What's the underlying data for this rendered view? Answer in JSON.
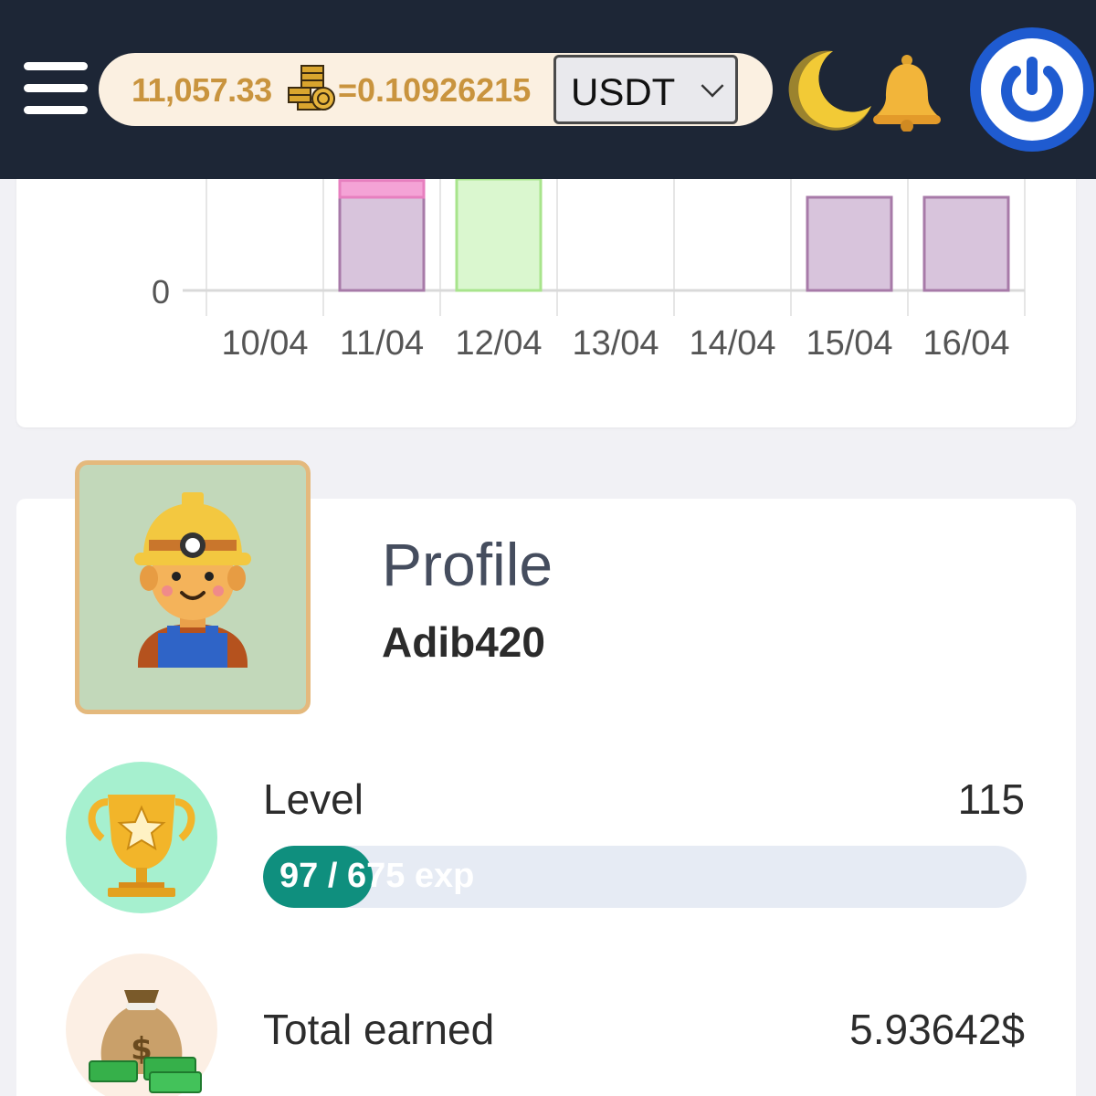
{
  "header": {
    "balance": "11,057.33",
    "rate": "=0.10926215",
    "currency": "USDT",
    "icons": [
      "menu-icon",
      "coins-icon",
      "moon-icon",
      "bell-icon",
      "power-icon"
    ]
  },
  "chart_data": {
    "type": "bar",
    "categories": [
      "10/04",
      "11/04",
      "12/04",
      "13/04",
      "14/04",
      "15/04",
      "16/04"
    ],
    "y_tick_visible": "0",
    "series": [
      {
        "values": [
          0,
          1,
          0,
          0,
          0,
          1,
          1
        ],
        "color": "#d8c4dc"
      },
      {
        "values": [
          0,
          0.18,
          0,
          0,
          0,
          0,
          0
        ],
        "color": "#f4a3d6"
      },
      {
        "values": [
          0,
          0,
          1.2,
          0,
          0,
          0,
          0
        ],
        "color": "#daf7cf"
      }
    ],
    "grid": "vertical"
  },
  "profile": {
    "title": "Profile",
    "username": "Adib420"
  },
  "level": {
    "label": "Level",
    "value": "115",
    "exp_text": "97 / 675 exp",
    "exp_fraction": 0.1437
  },
  "earned": {
    "label": "Total earned",
    "value": "5.93642$"
  }
}
